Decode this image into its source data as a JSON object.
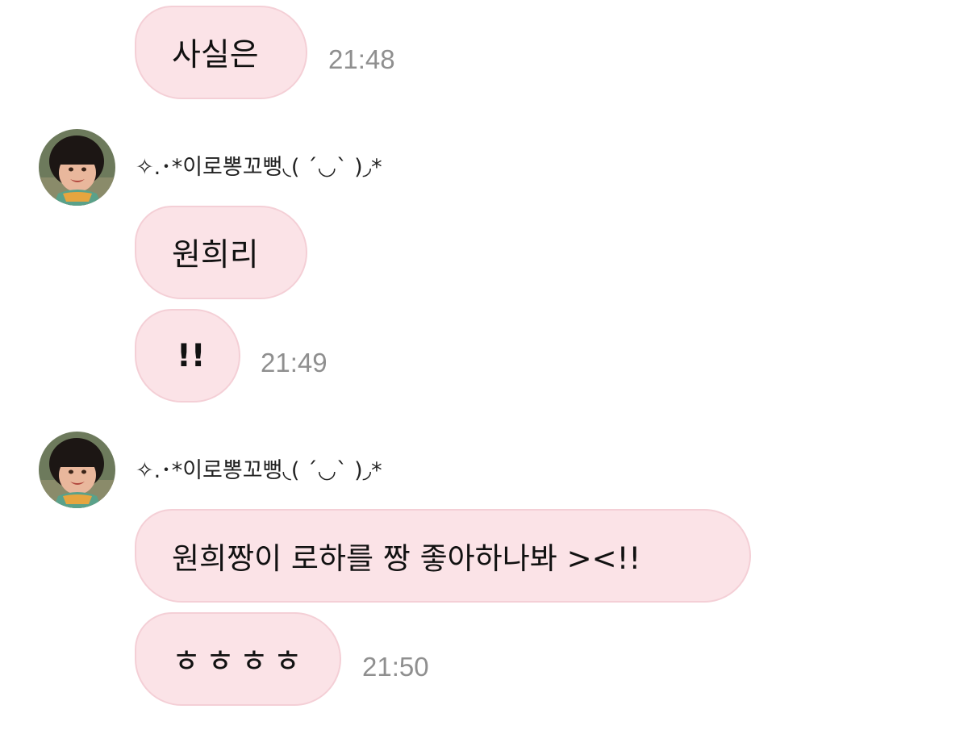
{
  "conversation": {
    "messages": [
      {
        "text": "사실은",
        "time": "21:48"
      },
      {
        "text": "원희리",
        "time": ""
      },
      {
        "text": "!!",
        "time": "21:49"
      },
      {
        "text": "원희짱이 로하를 짱 좋아하나봐 ><!!",
        "time": ""
      },
      {
        "text": "ㅎㅎㅎㅎ",
        "time": "21:50"
      }
    ],
    "groups": [
      {
        "sender": "✧.･*이로뽕꼬뻥◟( ˊ◡ˋ )◞*"
      },
      {
        "sender": "✧.･*이로뽕꼬뻥◟( ˊ◡ˋ )◞*"
      }
    ]
  },
  "colors": {
    "bubble_bg": "#fbe3e7",
    "bubble_border": "#f4cfd6",
    "timestamp": "#8f8f8f"
  },
  "icons": {
    "avatar": "child-profile-photo"
  }
}
